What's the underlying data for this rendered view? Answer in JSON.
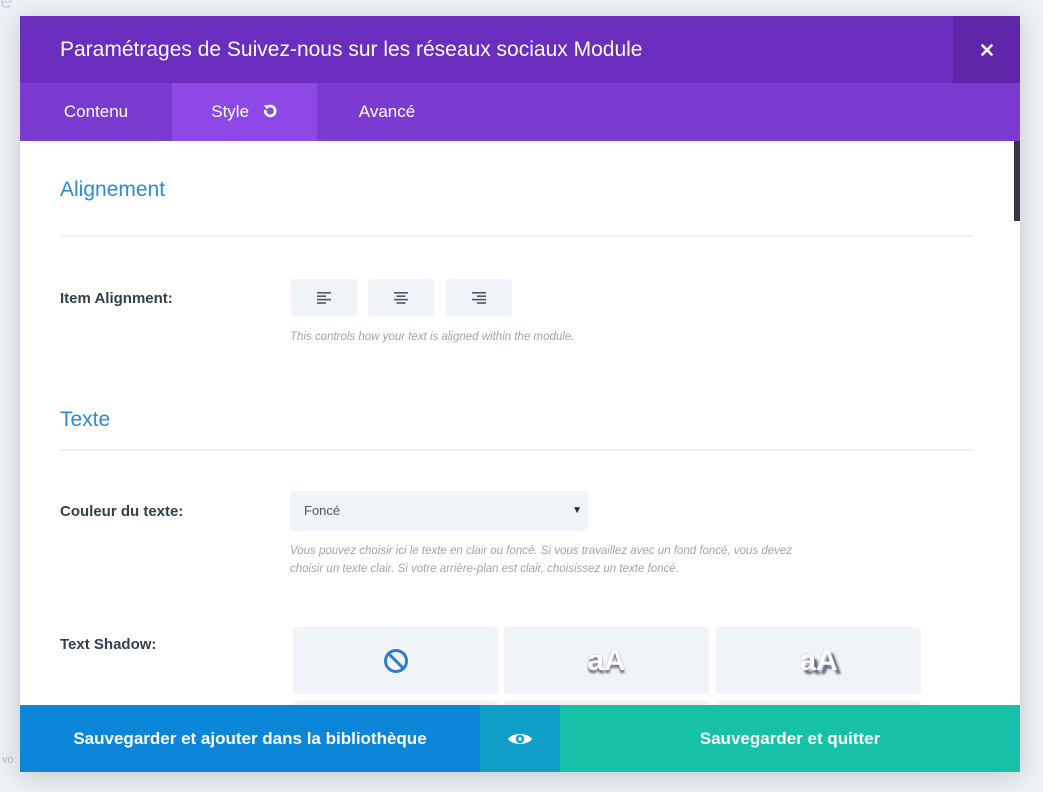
{
  "background": {
    "corner_text": "e",
    "footer_hint": "vo"
  },
  "modal": {
    "title": "Paramétrages de Suivez-nous sur les réseaux sociaux Module",
    "close_icon": "close-icon"
  },
  "tabs": [
    {
      "label": "Contenu",
      "active": false
    },
    {
      "label": "Style",
      "active": true,
      "icon": "reset-icon"
    },
    {
      "label": "Avancé",
      "active": false
    }
  ],
  "sections": {
    "alignment": {
      "title": "Alignement",
      "item_alignment": {
        "label": "Item Alignment:",
        "options": [
          "align-left-icon",
          "align-center-icon",
          "align-right-icon"
        ],
        "description": "This controls how your text is aligned within the module."
      }
    },
    "text": {
      "title": "Texte",
      "text_color": {
        "label": "Couleur du texte:",
        "selected": "Foncé",
        "description_line1": "Vous pouvez choisir ici le texte en clair ou foncé. Si vous travaillez avec un fond foncé, vous devez",
        "description_line2": "choisir un texte clair. Si votre arrière-plan est clair, choisissez un texte foncé."
      },
      "text_shadow": {
        "label": "Text Shadow:",
        "options": [
          "no-shadow-icon",
          "aA",
          "aA"
        ]
      }
    }
  },
  "footer": {
    "save_library": "Sauvegarder et ajouter dans la bibliothèque",
    "preview_icon": "eye-icon",
    "save_quit": "Sauvegarder et quitter"
  },
  "colors": {
    "header": "#6b2dbd",
    "tabs": "#7b3bd0",
    "active_tab": "#8d48e6",
    "section_title": "#2e8ad3",
    "save_library": "#0c86d8",
    "preview": "#0f9fc7",
    "save_quit": "#17c1a7"
  }
}
